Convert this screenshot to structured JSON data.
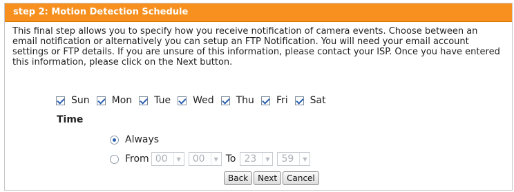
{
  "header": {
    "title": "step 2: Motion Detection Schedule"
  },
  "description": "This final step allows you to specify how you receive notification of camera events. Choose between an email notification or alternatively you can setup an FTP Notification. You will need your email account settings or FTP details. If you are unsure of this information, please contact your ISP. Once you have entered this information, please click on the Next button.",
  "days": [
    {
      "label": "Sun",
      "checked": true
    },
    {
      "label": "Mon",
      "checked": true
    },
    {
      "label": "Tue",
      "checked": true
    },
    {
      "label": "Wed",
      "checked": true
    },
    {
      "label": "Thu",
      "checked": true
    },
    {
      "label": "Fri",
      "checked": true
    },
    {
      "label": "Sat",
      "checked": true
    }
  ],
  "time": {
    "label": "Time",
    "always_label": "Always",
    "always_selected": true,
    "from_label": "From",
    "to_label": "To",
    "from_hour": "00",
    "from_minute": "00",
    "to_hour": "23",
    "to_minute": "59"
  },
  "buttons": {
    "back": "Back",
    "next": "Next",
    "cancel": "Cancel"
  },
  "colors": {
    "header_bg": "#f7901e",
    "header_text": "#ffffff"
  }
}
